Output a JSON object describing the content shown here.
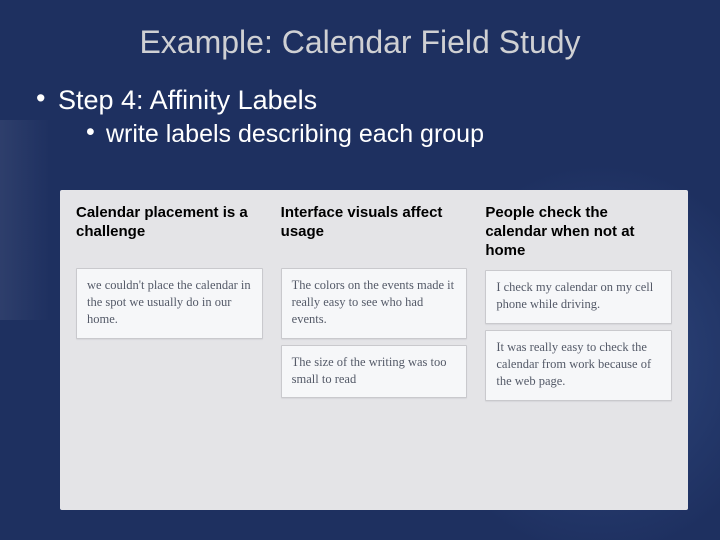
{
  "title": "Example: Calendar Field Study",
  "bullets": {
    "l1": "Step 4: Affinity Labels",
    "l2": "write labels describing each group"
  },
  "columns": [
    {
      "label": "Calendar placement is a challenge",
      "notes": [
        "we couldn't place the calendar in the spot we usually do in our home."
      ]
    },
    {
      "label": "Interface visuals affect usage",
      "notes": [
        "The colors on the events made it really easy to see who had events.",
        "The size of the writing was too small to read"
      ]
    },
    {
      "label": "People check the calendar when not at home",
      "notes": [
        "I check my calendar on my cell phone while driving.",
        "It was really easy to check the calendar from work because of the web page."
      ]
    }
  ]
}
